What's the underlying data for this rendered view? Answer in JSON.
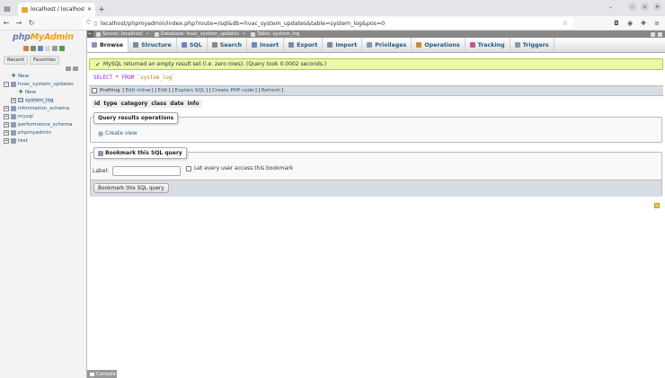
{
  "browser": {
    "tab_title": "localhost / localhost / hv",
    "url": "localhost/phpmyadmin/index.php?route=/sql&db=hvac_system_updates&table=system_log&pos=0"
  },
  "left": {
    "logo_php": "php",
    "logo_my": "MyAdmin",
    "tab_recent": "Recent",
    "tab_favorites": "Favorites",
    "tree": [
      {
        "label": "New",
        "level": 0,
        "kind": "new"
      },
      {
        "label": "hvac_system_updates",
        "level": 0,
        "kind": "db",
        "expanded": true
      },
      {
        "label": "New",
        "level": 1,
        "kind": "new"
      },
      {
        "label": "system_log",
        "level": 1,
        "kind": "table"
      },
      {
        "label": "information_schema",
        "level": 0,
        "kind": "db"
      },
      {
        "label": "mysql",
        "level": 0,
        "kind": "db"
      },
      {
        "label": "performance_schema",
        "level": 0,
        "kind": "db"
      },
      {
        "label": "phpmyadmin",
        "level": 0,
        "kind": "db"
      },
      {
        "label": "test",
        "level": 0,
        "kind": "db"
      }
    ]
  },
  "breadcrumb": {
    "server": "Server: localhost",
    "database": "Database: hvac_system_updates",
    "table": "Table: system_log"
  },
  "menu": [
    "Browse",
    "Structure",
    "SQL",
    "Search",
    "Insert",
    "Export",
    "Import",
    "Privileges",
    "Operations",
    "Tracking",
    "Triggers"
  ],
  "message": "MySQL returned an empty result set (i.e. zero rows). (Query took 0.0002 seconds.)",
  "sql": {
    "select": "SELECT",
    "star": "*",
    "from": "FROM",
    "table": "`system_log`"
  },
  "sqlbar": {
    "profiling": "Profiling",
    "edit_inline": "Edit inline",
    "edit": "Edit",
    "explain": "Explain SQL",
    "php_code": "Create PHP code",
    "refresh": "Refresh"
  },
  "columns": [
    "id",
    "type",
    "category",
    "class",
    "date",
    "info"
  ],
  "query_ops": {
    "legend": "Query results operations",
    "create_view": "Create view"
  },
  "bookmark": {
    "legend": "Bookmark this SQL query",
    "label": "Label:",
    "share": "Let every user access this bookmark",
    "button": "Bookmark this SQL query"
  },
  "console": "Console"
}
